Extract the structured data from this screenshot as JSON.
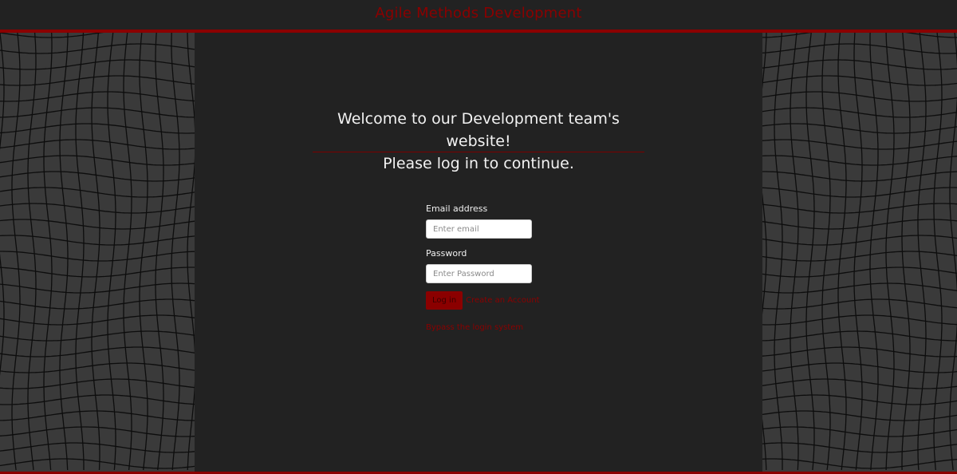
{
  "header": {
    "title": "Agile Methods Development"
  },
  "welcome": {
    "line1": "Welcome to our Development team's website!",
    "line2": "Please log in to continue."
  },
  "login_form": {
    "email_label": "Email address",
    "email_placeholder": "Enter email",
    "email_value": "",
    "password_label": "Password",
    "password_placeholder": "Enter Password",
    "password_value": "",
    "login_button": "Log in",
    "create_account_link": "Create an Account",
    "bypass_link": "Bypass the login system"
  },
  "colors": {
    "accent": "#8b0000",
    "panel_background": "#222222",
    "pattern_background": "#3a3a3a",
    "text": "#f2f2f2"
  }
}
